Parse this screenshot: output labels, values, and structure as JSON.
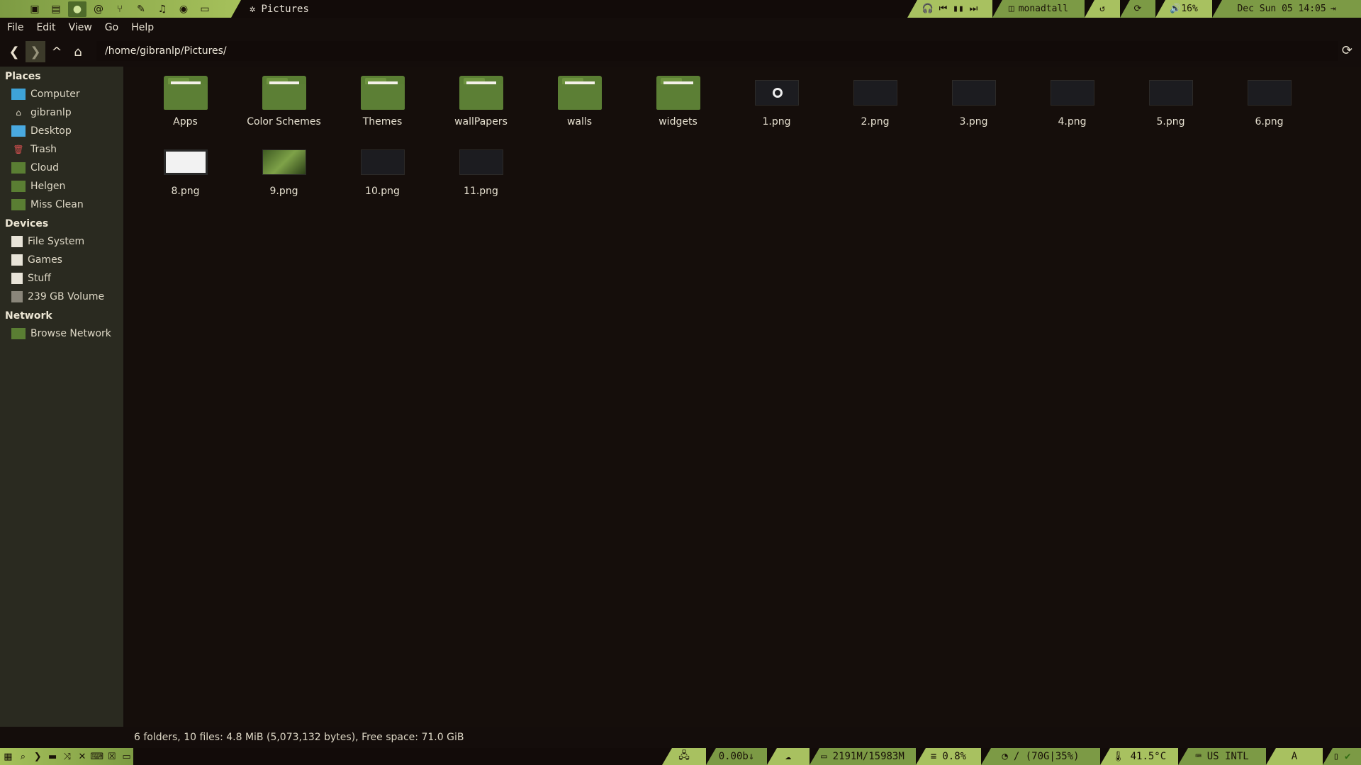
{
  "topbar": {
    "window_title": "Pictures",
    "media_icons": "🎧 ⏮ ▮▮ ⏭",
    "layout": "monadtall",
    "volume": "🔊16%",
    "clock": "Dec Sun 05 14:05",
    "launcher_icons": [
      "terminal-icon",
      "files-icon",
      "chat-icon",
      "at-icon",
      "git-icon",
      "brush-icon",
      "headphones-icon",
      "spotify-icon",
      "monitor-icon"
    ]
  },
  "menubar": {
    "items": [
      "File",
      "Edit",
      "View",
      "Go",
      "Help"
    ]
  },
  "location": {
    "path": "/home/gibranlp/Pictures/"
  },
  "sidebar": {
    "places_title": "Places",
    "places": [
      "Computer",
      "gibranlp",
      "Desktop",
      "Trash",
      "Cloud",
      "Helgen",
      "Miss Clean"
    ],
    "devices_title": "Devices",
    "devices": [
      "File System",
      "Games",
      "Stuff",
      "239 GB Volume"
    ],
    "network_title": "Network",
    "network": [
      "Browse Network"
    ]
  },
  "files": [
    {
      "name": "Apps",
      "type": "folder"
    },
    {
      "name": "Color Schemes",
      "type": "folder"
    },
    {
      "name": "Themes",
      "type": "folder"
    },
    {
      "name": "wallPapers",
      "type": "folder"
    },
    {
      "name": "walls",
      "type": "folder"
    },
    {
      "name": "widgets",
      "type": "folder"
    },
    {
      "name": "1.png",
      "type": "image"
    },
    {
      "name": "2.png",
      "type": "image"
    },
    {
      "name": "3.png",
      "type": "image"
    },
    {
      "name": "4.png",
      "type": "image"
    },
    {
      "name": "5.png",
      "type": "image"
    },
    {
      "name": "6.png",
      "type": "image"
    },
    {
      "name": "8.png",
      "type": "image"
    },
    {
      "name": "9.png",
      "type": "image"
    },
    {
      "name": "10.png",
      "type": "image"
    },
    {
      "name": "11.png",
      "type": "image"
    }
  ],
  "status": "6 folders, 10 files: 4.8 MiB (5,073,132 bytes), Free space: 71.0 GiB",
  "bottombar": {
    "net": "0.00b⇓",
    "memory": "2191M/15983M",
    "cpu": "0.8%",
    "disk": "/ (70G|35%)",
    "temp": "41.5°C",
    "keyboard": "US INTL",
    "kb_letter": "A"
  },
  "colors": {
    "accent_green": "#a8c160",
    "folder_green": "#5a7e33",
    "background": "#140d0b",
    "sidebar": "#2a2a20"
  }
}
